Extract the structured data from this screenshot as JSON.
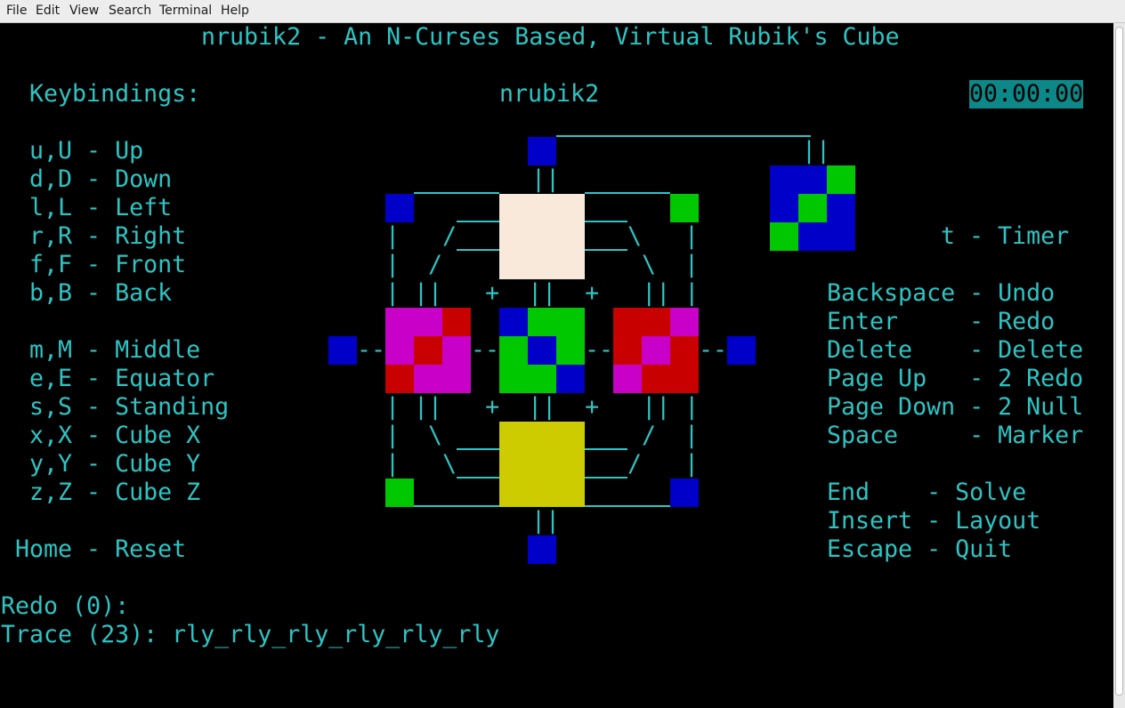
{
  "menubar": {
    "items": [
      "File",
      "Edit",
      "View",
      "Search",
      "Terminal",
      "Help"
    ]
  },
  "terminal": {
    "title": "nrubik2 - An N-Curses Based, Virtual Rubik's Cube",
    "keybindings_header": "Keybindings:",
    "app_name": "nrubik2",
    "timer": "00:00:00",
    "keybindings": [
      "u,U - Up",
      "d,D - Down",
      "l,L - Left",
      "r,R - Right",
      "f,F - Front",
      "b,B - Back",
      "m,M - Middle",
      "e,E - Equator",
      "s,S - Standing",
      "x,X - Cube X",
      "y,Y - Cube Y",
      "z,Z - Cube Z"
    ],
    "reset": "Home - Reset",
    "timer_key": "t - Timer",
    "special_keys": [
      "Backspace - Undo",
      "Enter     - Redo",
      "Delete    - Delete",
      "Page Up   - 2 Redo",
      "Page Down - 2 Null",
      "Space     - Marker",
      "End    - Solve",
      "Insert - Layout",
      "Escape - Quit"
    ],
    "redo_line": "Redo (0):",
    "trace_line": "Trace (23): rly_rly_rly_rly_rly_rly"
  },
  "cube_colors": {
    "white": "#f8e9da",
    "yellow": "#cccc00",
    "green": "#00c800",
    "blue": "#0000c8",
    "red": "#c80000",
    "magenta": "#c800c8",
    "cyan": "#2ec4c4"
  }
}
